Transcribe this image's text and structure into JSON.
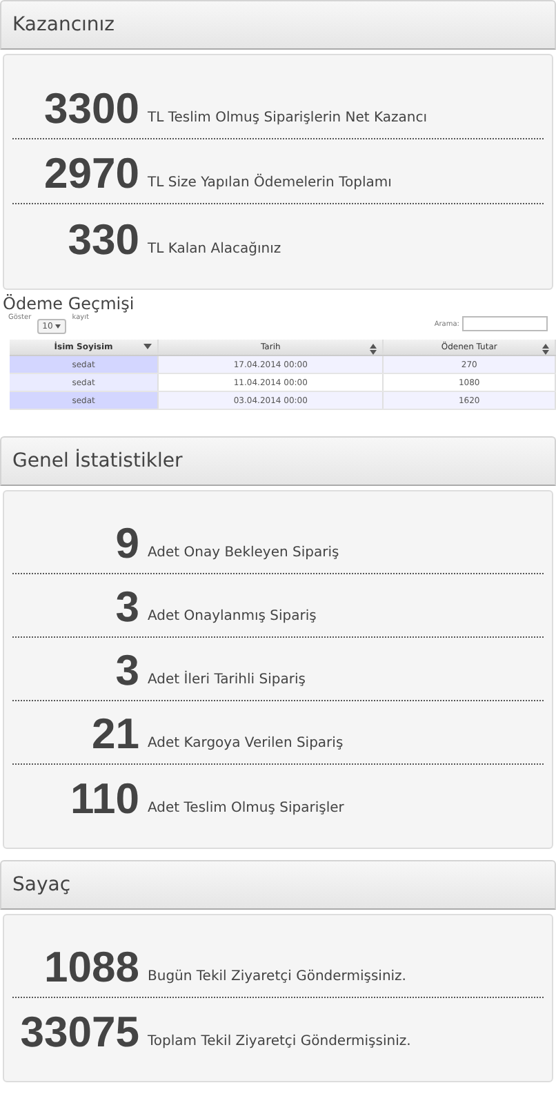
{
  "earnings": {
    "title": "Kazancınız",
    "rows": [
      {
        "value": "3300",
        "label": "TL Teslim Olmuş Siparişlerin Net Kazancı"
      },
      {
        "value": "2970",
        "label": "TL Size Yapılan Ödemelerin Toplamı"
      },
      {
        "value": "330",
        "label": "TL Kalan Alacağınız"
      }
    ]
  },
  "payments": {
    "title": "Ödeme Geçmişi",
    "show_label": "Göster",
    "page_size": "10",
    "records_label": "kayıt",
    "search_label": "Arama:",
    "columns": [
      {
        "label": "İsim Soyisim",
        "sorted": true
      },
      {
        "label": "Tarih",
        "sorted": false
      },
      {
        "label": "Ödenen Tutar",
        "sorted": false
      }
    ],
    "rows": [
      [
        "sedat",
        "17.04.2014 00:00",
        "270"
      ],
      [
        "sedat",
        "11.04.2014 00:00",
        "1080"
      ],
      [
        "sedat",
        "03.04.2014 00:00",
        "1620"
      ]
    ]
  },
  "stats": {
    "title": "Genel İstatistikler",
    "rows": [
      {
        "value": "9",
        "label": "Adet Onay Bekleyen Sipariş"
      },
      {
        "value": "3",
        "label": "Adet Onaylanmış Sipariş"
      },
      {
        "value": "3",
        "label": "Adet İleri Tarihli Sipariş"
      },
      {
        "value": "21",
        "label": "Adet Kargoya Verilen Sipariş"
      },
      {
        "value": "110",
        "label": "Adet Teslim Olmuş Siparişler"
      }
    ]
  },
  "counter": {
    "title": "Sayaç",
    "rows": [
      {
        "value": "1088",
        "label": "Bugün Tekil Ziyaretçi Göndermişsiniz."
      },
      {
        "value": "33075",
        "label": "Toplam Tekil Ziyaretçi Göndermişsiniz."
      }
    ]
  }
}
